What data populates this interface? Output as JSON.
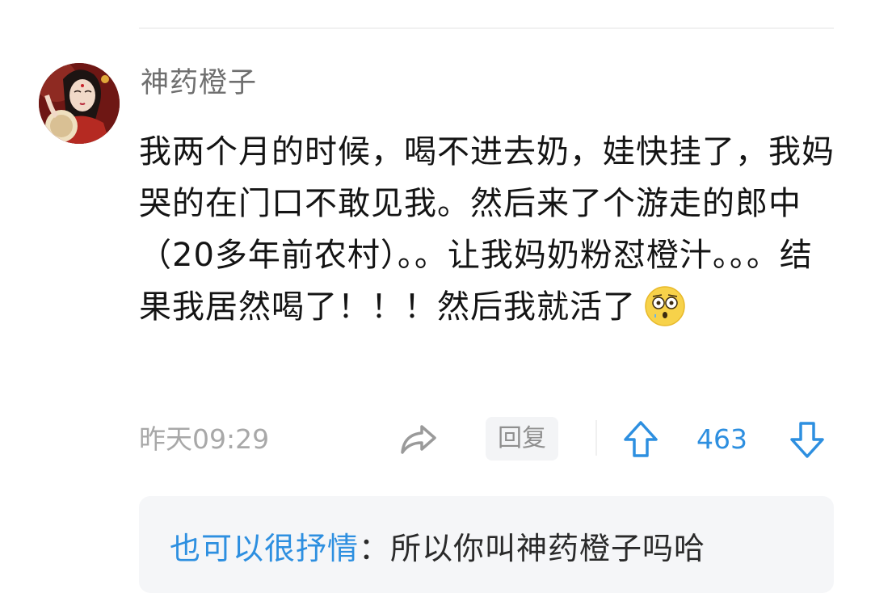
{
  "comment": {
    "username": "神药橙子",
    "text": "我两个月的时候，喝不进去奶，娃快挂了，我妈哭的在门口不敢见我。然后来了个游走的郎中（20多年前农村）。。让我妈奶粉怼橙汁。。。结果我居然喝了！！！然后我就活了",
    "emoji": "dizzy-stunned-face",
    "timestamp": "昨天09:29",
    "reply_label": "回复",
    "vote_count": "463"
  },
  "reply_preview": {
    "author": "也可以很抒情",
    "separator": "：",
    "text": "所以你叫神药橙子吗哈"
  },
  "colors": {
    "accent_blue": "#2d8fe0",
    "meta_gray": "#a8a8a8",
    "username_gray": "#6f6f6f",
    "text": "#141414",
    "reply_bg": "#f5f6f8"
  }
}
